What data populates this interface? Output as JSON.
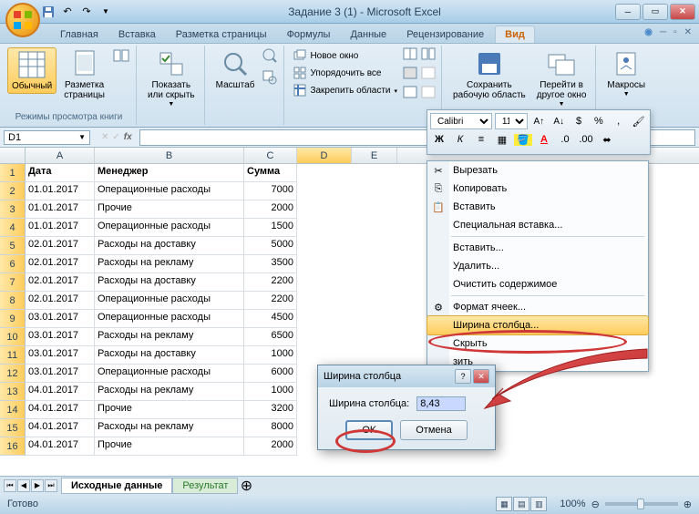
{
  "window": {
    "title": "Задание 3 (1) - Microsoft Excel"
  },
  "tabs": [
    "Главная",
    "Вставка",
    "Разметка страницы",
    "Формулы",
    "Данные",
    "Рецензирование",
    "Вид"
  ],
  "active_tab": 6,
  "ribbon": {
    "group1_label": "Режимы просмотра книги",
    "btn_normal": "Обычный",
    "btn_layout": "Разметка\nстраницы",
    "btn_show": "Показать\nили скрыть",
    "btn_zoom": "Масштаб",
    "btn_newwin": "Новое окно",
    "btn_arrange": "Упорядочить все",
    "btn_freeze": "Закрепить области",
    "btn_save": "Сохранить\nрабочую область",
    "btn_goto": "Перейти в\nдругое окно",
    "btn_macros": "Макросы"
  },
  "namebox": "D1",
  "mini": {
    "font": "Calibri",
    "size": "11"
  },
  "headers": [
    "A",
    "B",
    "C",
    "D",
    "E"
  ],
  "th": {
    "a": "Дата",
    "b": "Менеджер",
    "c": "Сумма"
  },
  "rows": [
    {
      "a": "01.01.2017",
      "b": "Операционные расходы",
      "c": "7000"
    },
    {
      "a": "01.01.2017",
      "b": "Прочие",
      "c": "2000"
    },
    {
      "a": "01.01.2017",
      "b": "Операционные расходы",
      "c": "1500"
    },
    {
      "a": "02.01.2017",
      "b": "Расходы на доставку",
      "c": "5000"
    },
    {
      "a": "02.01.2017",
      "b": "Расходы на рекламу",
      "c": "3500"
    },
    {
      "a": "02.01.2017",
      "b": "Расходы на доставку",
      "c": "2200"
    },
    {
      "a": "02.01.2017",
      "b": "Операционные расходы",
      "c": "2200"
    },
    {
      "a": "03.01.2017",
      "b": "Операционные расходы",
      "c": "4500"
    },
    {
      "a": "03.01.2017",
      "b": "Расходы на рекламу",
      "c": "6500"
    },
    {
      "a": "03.01.2017",
      "b": "Расходы на доставку",
      "c": "1000"
    },
    {
      "a": "03.01.2017",
      "b": "Операционные расходы",
      "c": "6000"
    },
    {
      "a": "04.01.2017",
      "b": "Расходы на рекламу",
      "c": "1000"
    },
    {
      "a": "04.01.2017",
      "b": "Прочие",
      "c": "3200"
    },
    {
      "a": "04.01.2017",
      "b": "Расходы на рекламу",
      "c": "8000"
    },
    {
      "a": "04.01.2017",
      "b": "Прочие",
      "c": "2000"
    }
  ],
  "sheets": {
    "s1": "Исходные данные",
    "s2": "Результат"
  },
  "status": {
    "ready": "Готово",
    "zoom": "100%"
  },
  "cm": {
    "cut": "Вырезать",
    "copy": "Копировать",
    "paste": "Вставить",
    "pastespec": "Специальная вставка...",
    "insert": "Вставить...",
    "delete": "Удалить...",
    "clear": "Очистить содержимое",
    "format": "Формат ячеек...",
    "width": "Ширина столбца...",
    "hide": "Скрыть",
    "unhide": "зить"
  },
  "dialog": {
    "title": "Ширина столбца",
    "label": "Ширина столбца:",
    "value": "8,43",
    "ok": "OK",
    "cancel": "Отмена"
  }
}
